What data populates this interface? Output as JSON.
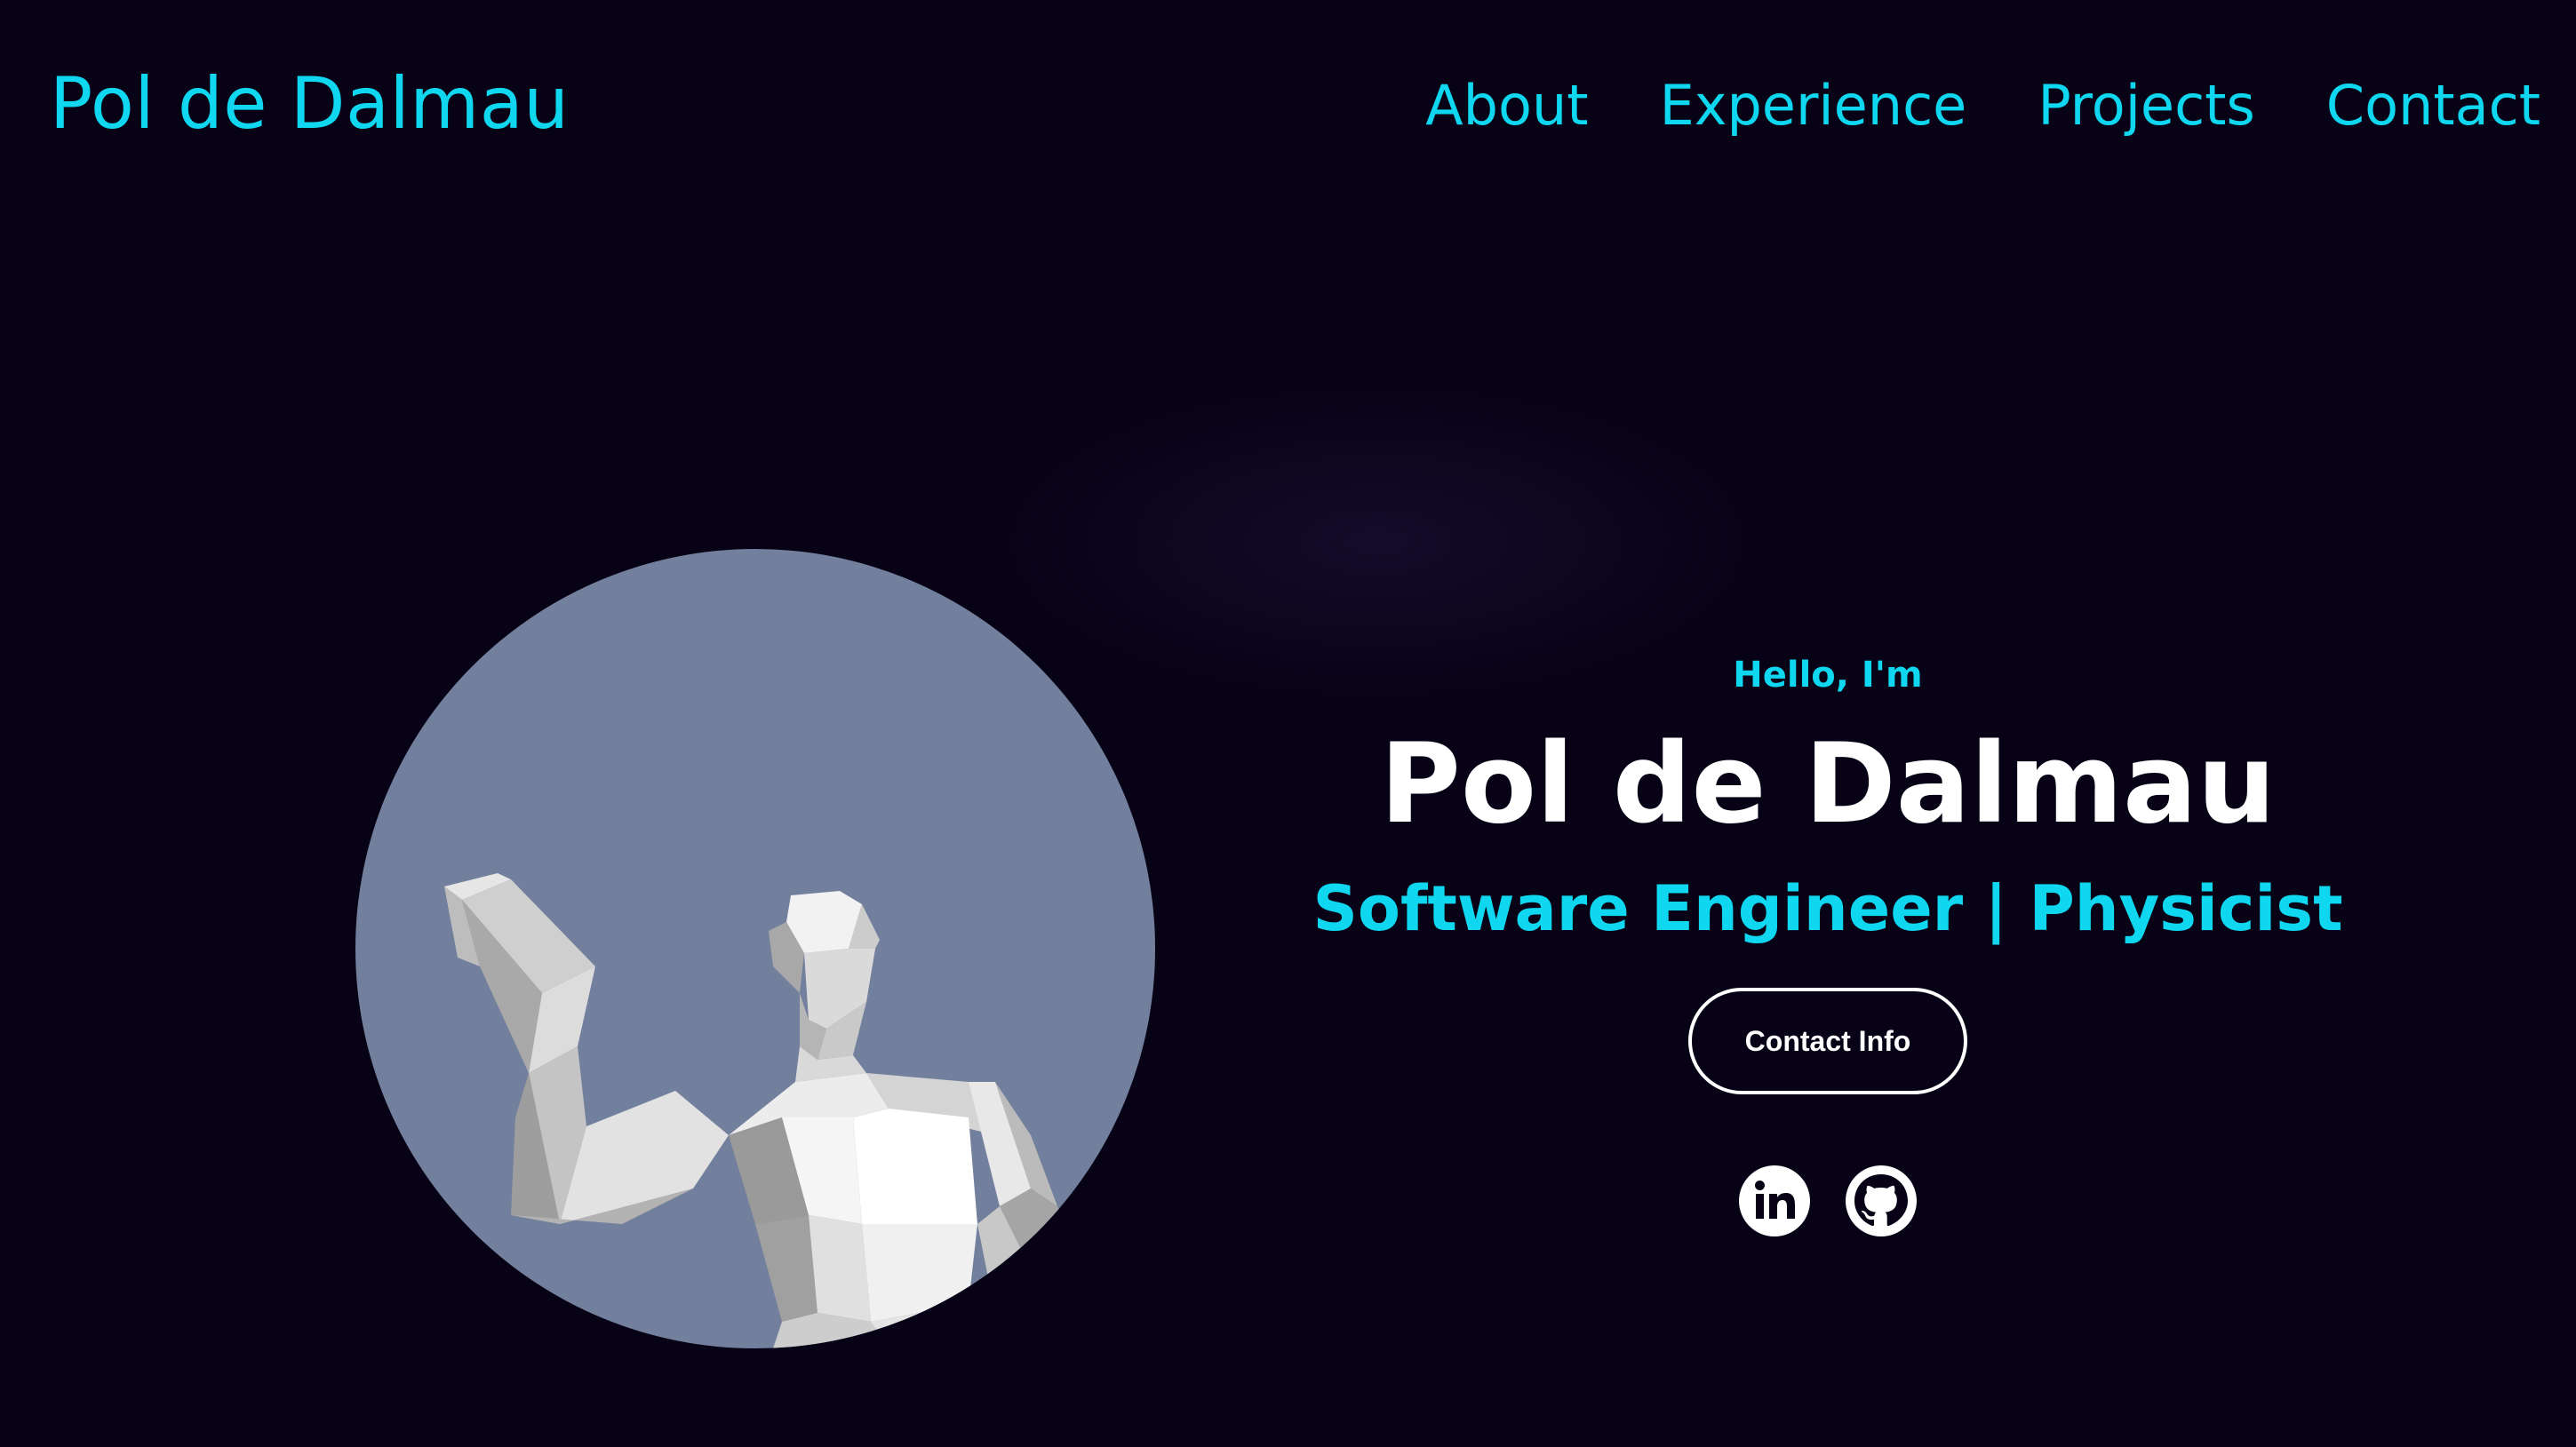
{
  "header": {
    "logo": "Pol de Dalmau",
    "nav": [
      "About",
      "Experience",
      "Projects",
      "Contact"
    ]
  },
  "hero": {
    "greeting": "Hello, I'm",
    "name": "Pol de Dalmau",
    "roles": "Software Engineer | Physicist",
    "contact_button": "Contact Info",
    "socials": [
      {
        "name": "linkedin-icon"
      },
      {
        "name": "github-icon"
      }
    ],
    "avatar": "low-poly-figure-illustration"
  },
  "colors": {
    "background": "#070215",
    "accent": "#0fd7f0",
    "text": "#ffffff",
    "avatar_bg": "#72809d"
  }
}
